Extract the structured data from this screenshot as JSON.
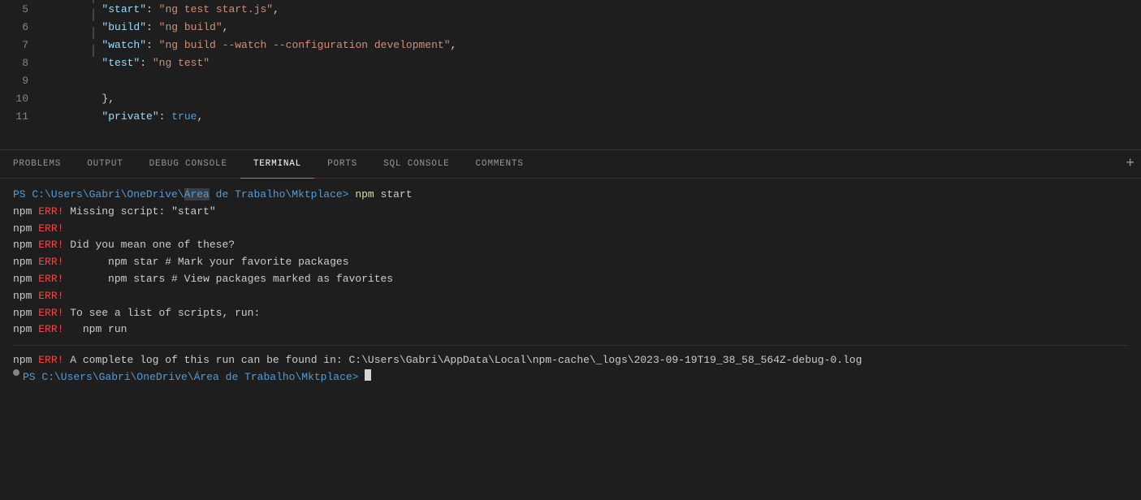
{
  "editor": {
    "lines": [
      {
        "num": "5",
        "content": "\"start\": \"ng test start.js\",",
        "indent": 2,
        "type": "string-pair"
      },
      {
        "num": "6",
        "content": "\"build\": \"ng build\",",
        "indent": 2,
        "type": "string-pair"
      },
      {
        "num": "7",
        "content": "\"watch\": \"ng build --watch --configuration development\",",
        "indent": 2,
        "type": "string-pair"
      },
      {
        "num": "8",
        "content": "\"test\": \"ng test\"",
        "indent": 2,
        "type": "string-pair"
      },
      {
        "num": "9",
        "content": "",
        "indent": 0,
        "type": "empty"
      },
      {
        "num": "10",
        "content": "},",
        "indent": 1,
        "type": "punct"
      },
      {
        "num": "11",
        "content": "\"private\": true,",
        "indent": 1,
        "type": "mixed"
      }
    ]
  },
  "tabs": {
    "items": [
      {
        "id": "problems",
        "label": "PROBLEMS",
        "active": false
      },
      {
        "id": "output",
        "label": "OUTPUT",
        "active": false
      },
      {
        "id": "debug-console",
        "label": "DEBUG CONSOLE",
        "active": false
      },
      {
        "id": "terminal",
        "label": "TERMINAL",
        "active": true
      },
      {
        "id": "ports",
        "label": "PORTS",
        "active": false
      },
      {
        "id": "sql-console",
        "label": "SQL CONSOLE",
        "active": false
      },
      {
        "id": "comments",
        "label": "COMMENTS",
        "active": false
      }
    ],
    "end_icon": "+"
  },
  "terminal": {
    "prompt_path": "PS C:\\Users\\Gabri\\OneDrive\\Área de Trabalho\\Mktplace>",
    "command": "npm start",
    "lines": [
      {
        "type": "error",
        "parts": [
          {
            "text": "npm",
            "class": "t-white"
          },
          {
            "text": " ERR!",
            "class": "t-red"
          },
          {
            "text": " Missing script: \"start\"",
            "class": "t-white"
          }
        ]
      },
      {
        "type": "error",
        "parts": [
          {
            "text": "npm",
            "class": "t-white"
          },
          {
            "text": " ERR!",
            "class": "t-red"
          }
        ]
      },
      {
        "type": "error",
        "parts": [
          {
            "text": "npm",
            "class": "t-white"
          },
          {
            "text": " ERR!",
            "class": "t-red"
          },
          {
            "text": " Did you mean one of these?",
            "class": "t-white"
          }
        ]
      },
      {
        "type": "error",
        "parts": [
          {
            "text": "npm",
            "class": "t-white"
          },
          {
            "text": " ERR!",
            "class": "t-red"
          },
          {
            "text": "       npm star # Mark your favorite packages",
            "class": "t-white"
          }
        ]
      },
      {
        "type": "error",
        "parts": [
          {
            "text": "npm",
            "class": "t-white"
          },
          {
            "text": " ERR!",
            "class": "t-red"
          },
          {
            "text": "       npm stars # View packages marked as favorites",
            "class": "t-white"
          }
        ]
      },
      {
        "type": "error",
        "parts": [
          {
            "text": "npm",
            "class": "t-white"
          },
          {
            "text": " ERR!",
            "class": "t-red"
          }
        ]
      },
      {
        "type": "error",
        "parts": [
          {
            "text": "npm",
            "class": "t-white"
          },
          {
            "text": " ERR!",
            "class": "t-red"
          },
          {
            "text": " To see a list of scripts, run:",
            "class": "t-white"
          }
        ]
      },
      {
        "type": "error",
        "parts": [
          {
            "text": "npm",
            "class": "t-white"
          },
          {
            "text": " ERR!",
            "class": "t-red"
          },
          {
            "text": "   npm run",
            "class": "t-white"
          }
        ]
      }
    ],
    "log_line": "npm ERR! A complete log of this run can be found in: C:\\Users\\Gabri\\AppData\\Local\\npm-cache\\_logs\\2023-09-19T19_38_58_564Z-debug-0.log",
    "final_prompt": "PS C:\\Users\\Gabri\\OneDrive\\Área de Trabalho\\Mktplace>"
  },
  "colors": {
    "active_tab_underline": "#3794ff",
    "error_red": "#f44747",
    "terminal_yellow": "#dcdcaa",
    "terminal_bg": "#1e1e1e"
  }
}
